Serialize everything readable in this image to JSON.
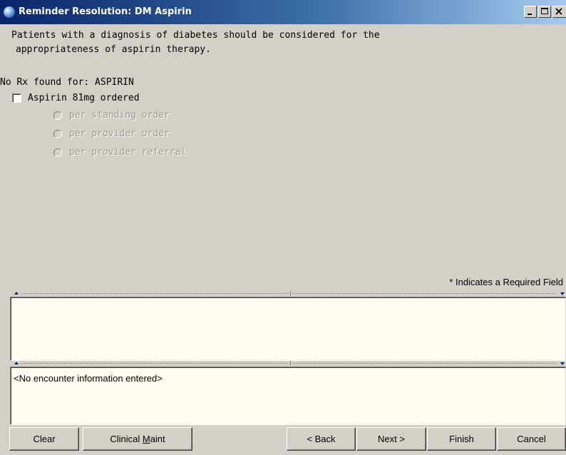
{
  "window": {
    "title": "Reminder Resolution: DM Aspirin",
    "controls": [
      "minimize-icon",
      "maximize-icon",
      "close-icon"
    ]
  },
  "dialog": {
    "description_line1": "Patients with a diagnosis of diabetes should be considered for the",
    "description_line2": "appropriateness of aspirin therapy.",
    "no_rx_text": "No Rx found for: ASPIRIN",
    "checkbox": {
      "label": "Aspirin 81mg ordered",
      "checked": false
    },
    "radio_options": [
      {
        "label": "per standing order",
        "enabled": false
      },
      {
        "label": "per provider order",
        "enabled": false
      },
      {
        "label": "per provider referral",
        "enabled": false
      }
    ],
    "required_note": "* Indicates a Required Field"
  },
  "encounter": {
    "text": "<No encounter information entered>"
  },
  "buttons": {
    "clear": "Clear",
    "clinical_maint_prefix": "Clinical ",
    "clinical_maint_accel": "M",
    "clinical_maint_suffix": "aint",
    "back": "< Back",
    "next": "Next >",
    "finish": "Finish",
    "cancel": "Cancel"
  },
  "colors": {
    "window_bg": "#d4d0c8",
    "title_bar_start": "#0a246a",
    "title_bar_end": "#a6caf0",
    "pane_bg": "#fffdf1",
    "disabled_text": "#9e9a92"
  }
}
